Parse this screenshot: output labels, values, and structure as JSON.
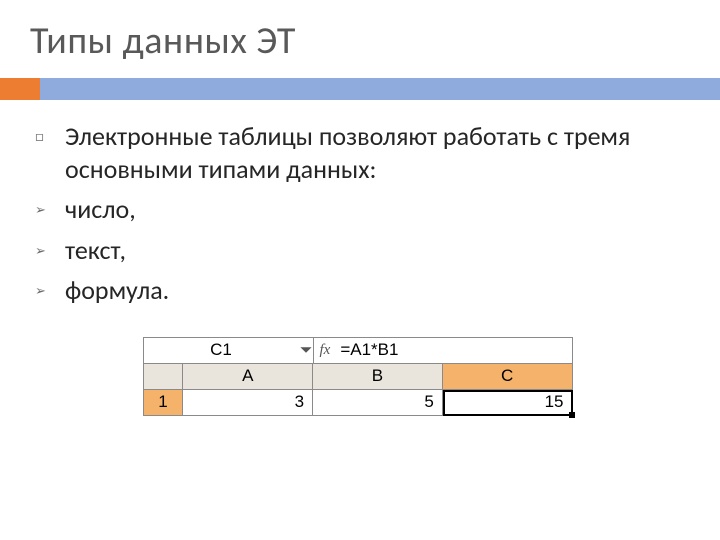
{
  "title": "Типы данных ЭТ",
  "bullets": {
    "intro": "Электронные таблицы позволяют работать с тремя основными типами данных:",
    "items": [
      "число,",
      "текст,",
      "формула."
    ]
  },
  "excel": {
    "namebox": "C1",
    "fx_label": "fx",
    "formula": "=A1*B1",
    "columns": [
      "A",
      "B",
      "C"
    ],
    "row_header": "1",
    "cells": [
      "3",
      "5",
      "15"
    ]
  }
}
